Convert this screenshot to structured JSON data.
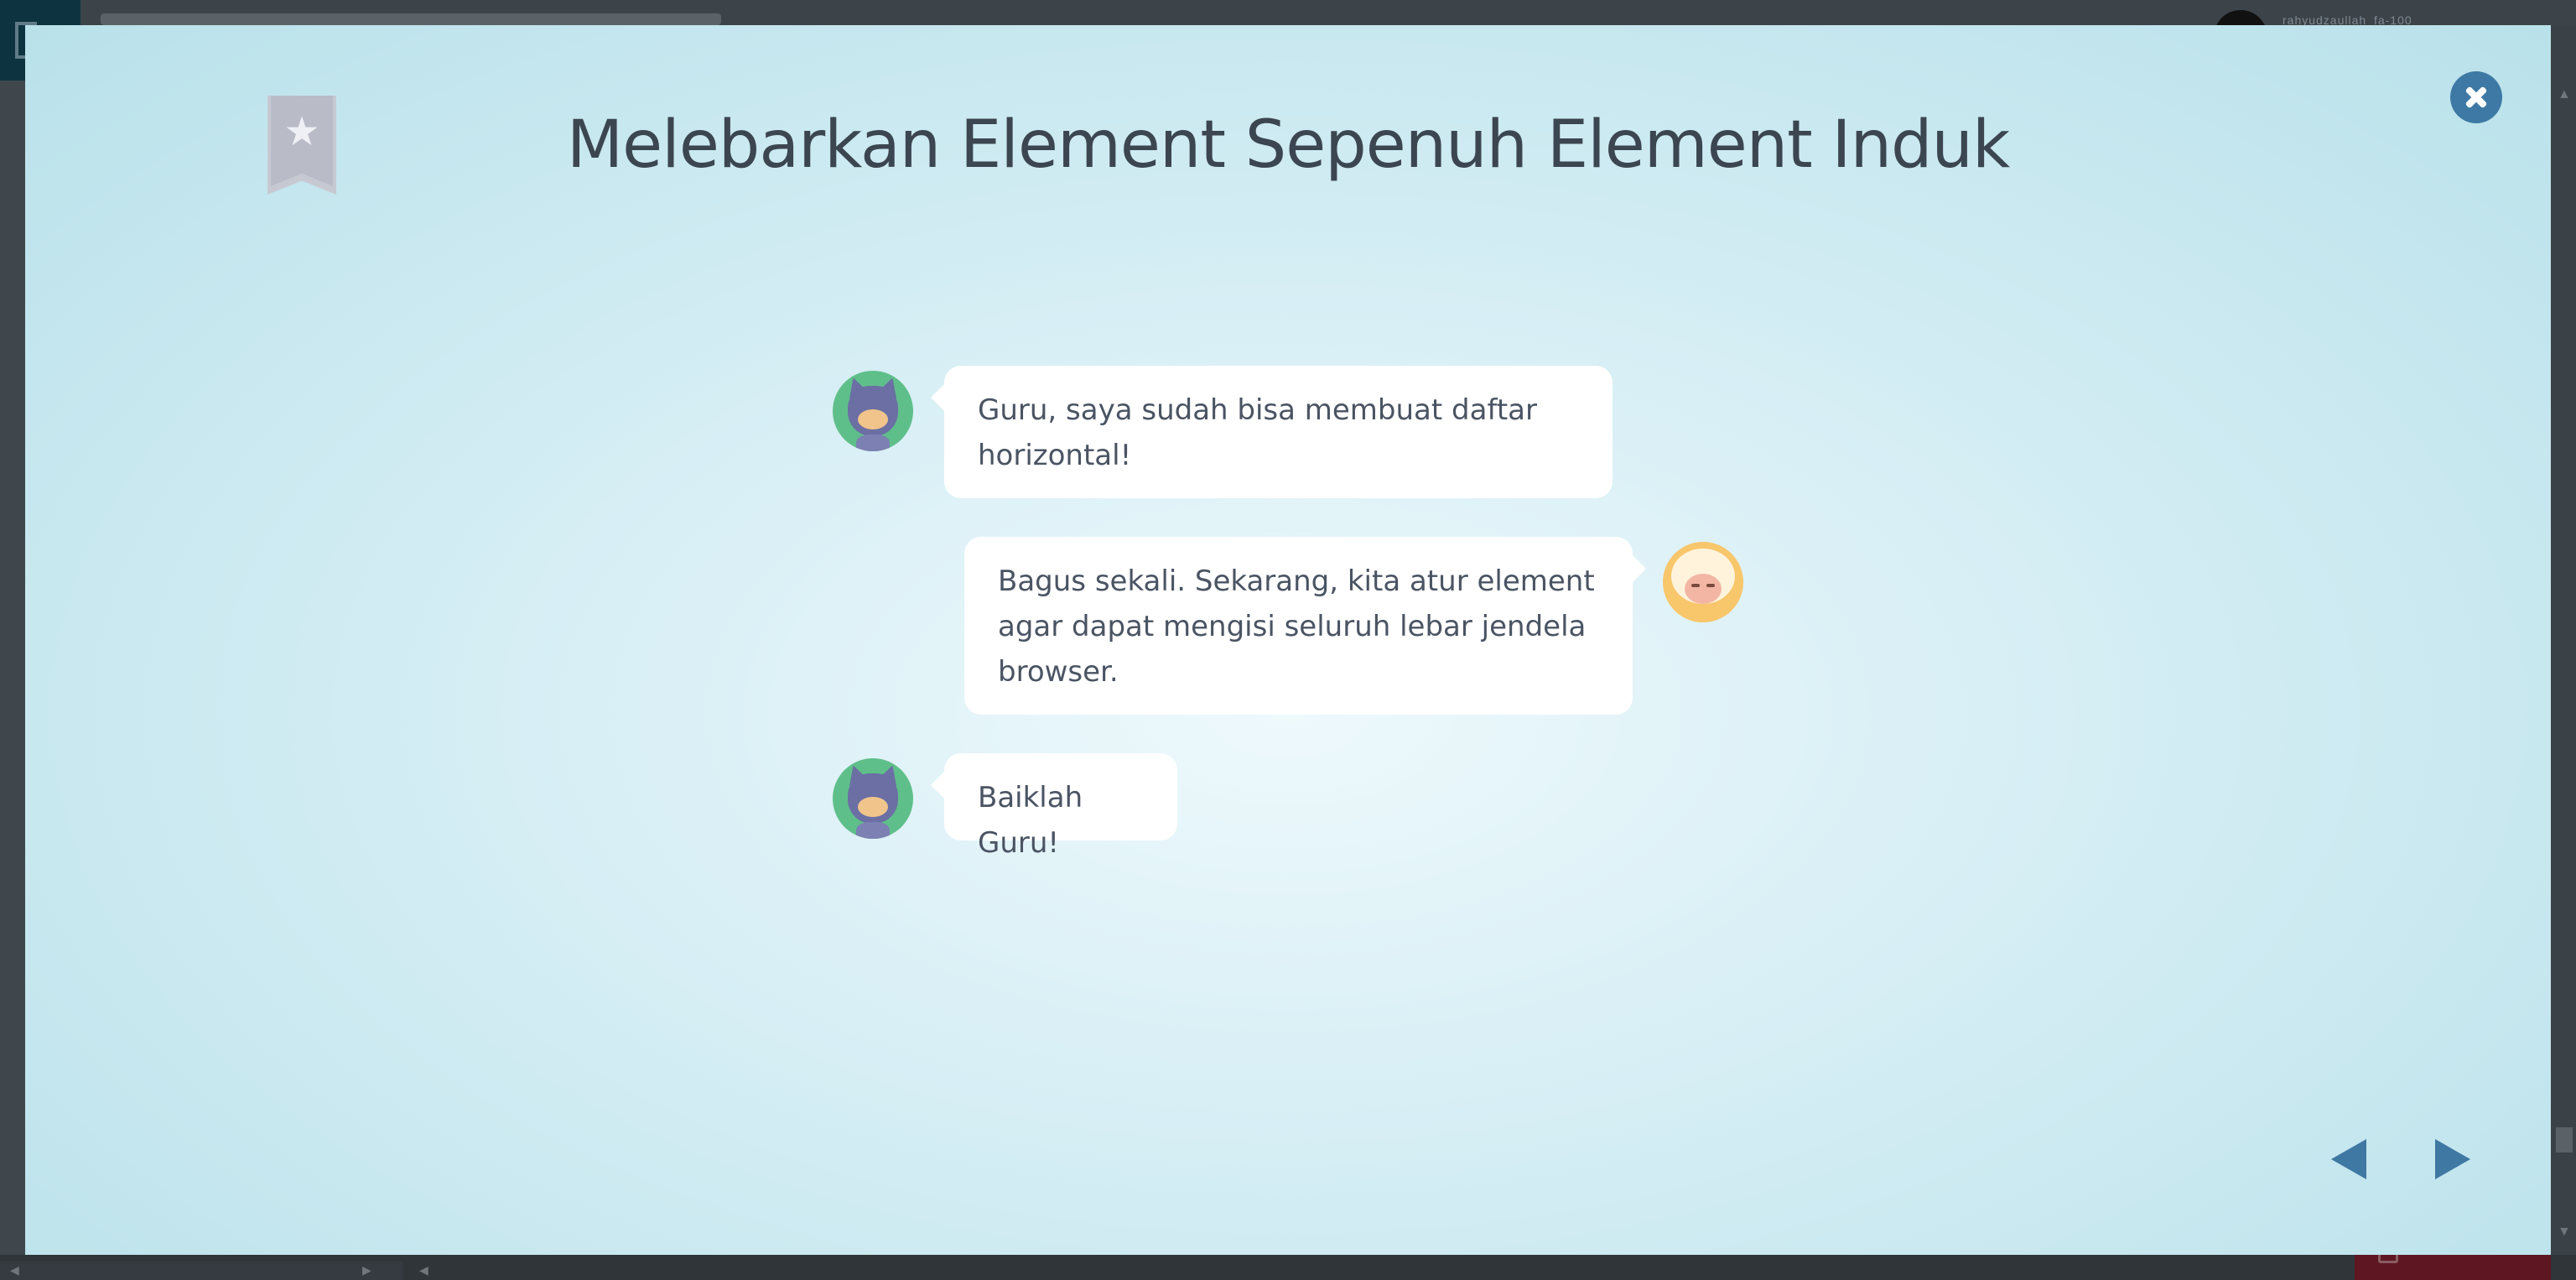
{
  "background": {
    "username": "rahyudzaullah_fa-100"
  },
  "modal": {
    "title": "Melebarkan Element Sepenuh Element Induk",
    "bookmark_icon": "bookmark-star-icon",
    "close_icon": "close-icon"
  },
  "chat": {
    "messages": [
      {
        "speaker": "student",
        "text": "Guru, saya sudah bisa membuat daftar horizontal!"
      },
      {
        "speaker": "teacher",
        "text": "Bagus sekali. Sekarang, kita atur element agar dapat mengisi seluruh lebar jendela browser."
      },
      {
        "speaker": "student",
        "text": "Baiklah Guru!"
      }
    ]
  },
  "navigation": {
    "prev_icon": "triangle-left-icon",
    "next_icon": "triangle-right-icon"
  },
  "colors": {
    "accent": "#3d79a4",
    "title_text": "#3c4650",
    "bubble_text": "#4a5463",
    "bookmark": "#c7c9d2"
  }
}
